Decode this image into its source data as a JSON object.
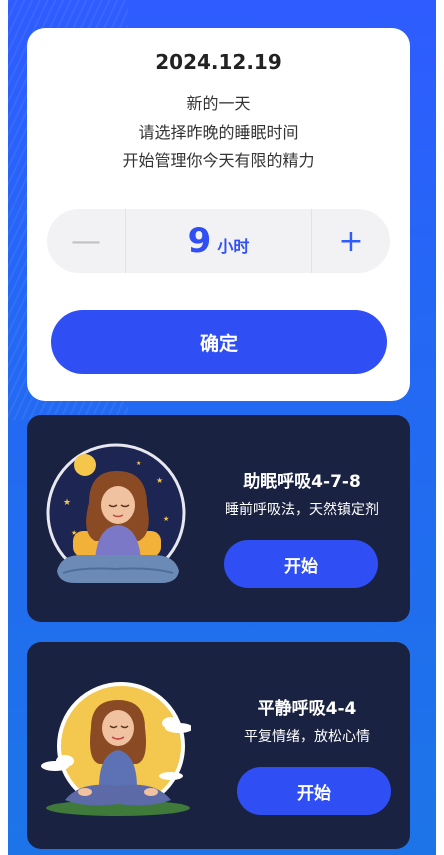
{
  "sleep_card": {
    "date": "2024.12.19",
    "line1": "新的一天",
    "line2": "请选择昨晚的睡眠时间",
    "line3": "开始管理你今天有限的精力",
    "stepper": {
      "minus": "—",
      "plus": "+",
      "value": "9",
      "unit": "小时"
    },
    "confirm_label": "确定"
  },
  "exercises": [
    {
      "title": "助眠呼吸4-7-8",
      "description": "睡前呼吸法，天然镇定剂",
      "start_label": "开始",
      "illustration": "sleeping-girl-night-illustration"
    },
    {
      "title": "平静呼吸4-4",
      "description": "平复情绪，放松心情",
      "start_label": "开始",
      "illustration": "meditating-woman-sun-illustration"
    }
  ],
  "colors": {
    "primary": "#2f4ff5",
    "background_blue": "#2467f5",
    "dark_card": "#1a2242"
  }
}
